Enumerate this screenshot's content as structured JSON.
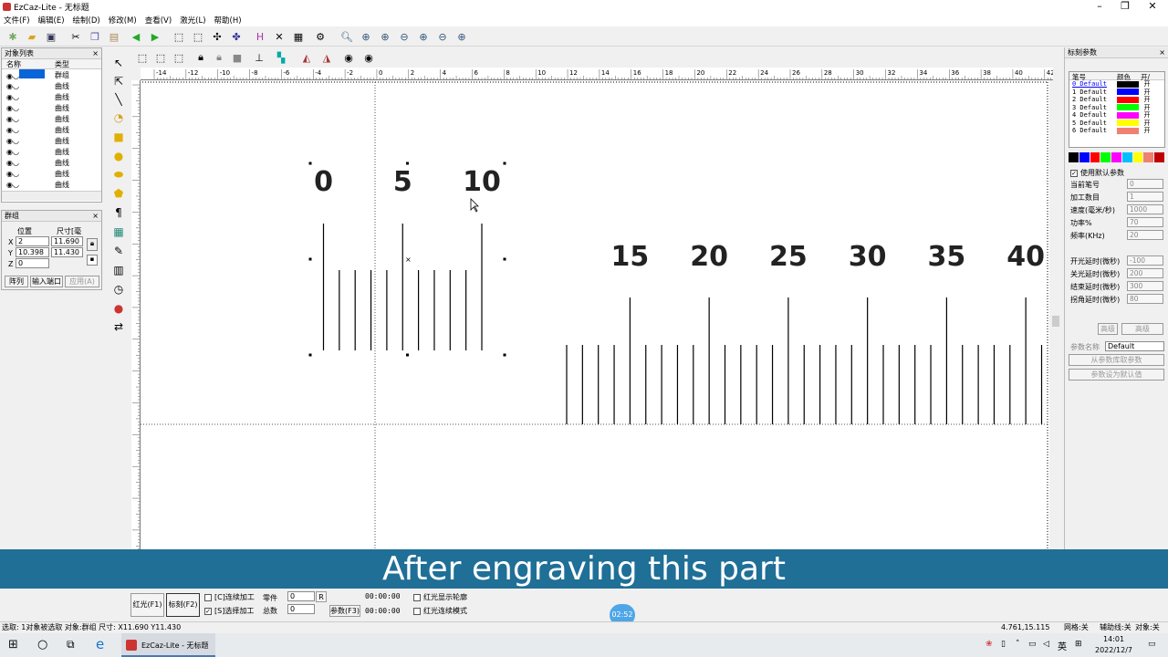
{
  "window": {
    "title": "EzCaz-Lite  - 无标题"
  },
  "menu": [
    "文件(F)",
    "编辑(E)",
    "绘制(D)",
    "修改(M)",
    "查看(V)",
    "激光(L)",
    "帮助(H)"
  ],
  "objects_panel": {
    "title": "对象列表",
    "columns": [
      "名称",
      "类型"
    ],
    "rows": [
      {
        "name": "",
        "type": "群组"
      },
      {
        "name": "",
        "type": "曲线"
      },
      {
        "name": "",
        "type": "曲线"
      },
      {
        "name": "",
        "type": "曲线"
      },
      {
        "name": "",
        "type": "曲线"
      },
      {
        "name": "",
        "type": "曲线"
      },
      {
        "name": "",
        "type": "曲线"
      },
      {
        "name": "",
        "type": "曲线"
      },
      {
        "name": "",
        "type": "曲线"
      },
      {
        "name": "",
        "type": "曲线"
      },
      {
        "name": "",
        "type": "曲线"
      }
    ]
  },
  "group_panel": {
    "title": "群组",
    "pos_label": "位置",
    "size_label": "尺寸[毫",
    "x_label": "X",
    "y_label": "Y",
    "z_label": "Z",
    "x": "2",
    "y": "10.398",
    "z": "0",
    "w": "11.690",
    "h": "11.430",
    "btn_array": "阵列",
    "btn_input": "输入端口",
    "btn_apply": "应用(A)"
  },
  "canvas": {
    "upper_numbers": [
      "0",
      "5",
      "10"
    ],
    "lower_numbers": [
      "15",
      "20",
      "25",
      "30",
      "35",
      "40"
    ],
    "ruler_labels": [
      "-14",
      "-12",
      "-10",
      "-8",
      "-6",
      "-4",
      "-2",
      "0",
      "2",
      "4",
      "6",
      "8",
      "10",
      "12",
      "14",
      "16",
      "18",
      "20",
      "22",
      "24",
      "26",
      "28",
      "30",
      "32",
      "34",
      "36",
      "38",
      "40",
      "42"
    ]
  },
  "marking_panel": {
    "title": "标刻参数",
    "columns": [
      "笔号",
      "颜色",
      "开/"
    ],
    "pens": [
      {
        "label": "0 Default",
        "color": "#000000",
        "on": "开"
      },
      {
        "label": "1 Default",
        "color": "#0000ff",
        "on": "开"
      },
      {
        "label": "2 Default",
        "color": "#ff0000",
        "on": "开"
      },
      {
        "label": "3 Default",
        "color": "#00ff00",
        "on": "开"
      },
      {
        "label": "4 Default",
        "color": "#ff00ff",
        "on": "开"
      },
      {
        "label": "5 Default",
        "color": "#ffff00",
        "on": "开"
      },
      {
        "label": "6 Default",
        "color": "#f08070",
        "on": "开"
      }
    ],
    "palette": [
      "#000000",
      "#0000ff",
      "#ff0000",
      "#00ff00",
      "#ff00ff",
      "#00c0ff",
      "#ffff00",
      "#f08070",
      "#c00000"
    ],
    "use_default": "使用默认参数",
    "params": [
      {
        "label": "当前笔号",
        "value": "0"
      },
      {
        "label": "加工数目",
        "value": "1"
      },
      {
        "label": "速度(毫米/秒)",
        "value": "1000"
      },
      {
        "label": "功率%",
        "value": "70"
      },
      {
        "label": "频率(KHz)",
        "value": "20"
      },
      {
        "label": "开光延时(微秒)",
        "value": "-100"
      },
      {
        "label": "关光延时(微秒)",
        "value": "200"
      },
      {
        "label": "结束延时(微秒)",
        "value": "300"
      },
      {
        "label": "拐角延时(微秒)",
        "value": "80"
      }
    ],
    "btn_a": "高级",
    "btn_b": "高级",
    "param_name_label": "参数名称",
    "param_name_value": "Default",
    "btn_from_lib": "从参数库取参数",
    "btn_set_default": "参数设为默认值"
  },
  "bottom": {
    "btn_red": "红光(F1)",
    "btn_mark": "标刻(F2)",
    "chk_continuous": "[C]连续加工",
    "chk_select": "[S]选择加工",
    "parts_label": "零件",
    "parts_value": "0",
    "btn_r": "R",
    "total_label": "总数",
    "total_value": "0",
    "time1": "00:00:00",
    "time2": "00:00:00",
    "btn_params": "参数(F3)",
    "chk_red_outline": "红光显示轮廓",
    "chk_red_continuous": "红光连续模式"
  },
  "caption": "After engraving this part",
  "video_time": "02:52",
  "status": {
    "left": "选取: 1对象被选取 对象:群组 尺寸: X11.690 Y11.430",
    "coords": "4.761,15.115",
    "grid": "网格:关",
    "guide": "辅助线:关",
    "obj": "对象:关"
  },
  "taskbar": {
    "app": "EzCaz-Lite - 无标题",
    "ime": "英",
    "time": "14:01",
    "date": "2022/12/7"
  }
}
